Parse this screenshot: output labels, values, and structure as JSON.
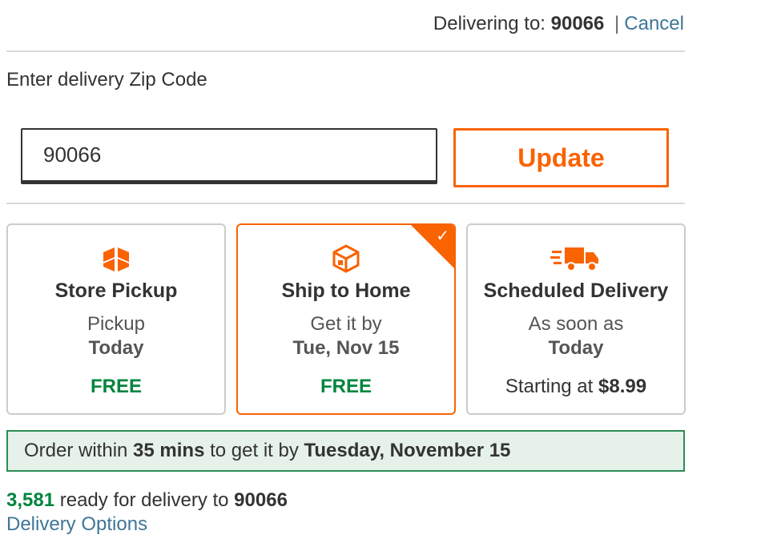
{
  "header": {
    "delivering_prefix": "Delivering to:",
    "delivering_zip": "90066",
    "separator": "|",
    "cancel_label": "Cancel"
  },
  "zip_form": {
    "label": "Enter delivery Zip Code",
    "value": "90066",
    "update_label": "Update"
  },
  "cards": [
    {
      "title": "Store Pickup",
      "line1": "Pickup",
      "line2": "Today",
      "price": "FREE",
      "icon": "store-pickup-box-icon",
      "selected": false
    },
    {
      "title": "Ship to Home",
      "line1": "Get it by",
      "line2": "Tue, Nov 15",
      "price": "FREE",
      "icon": "package-icon",
      "selected": true
    },
    {
      "title": "Scheduled Delivery",
      "line1": "As soon as",
      "line2": "Today",
      "price_prefix": "Starting at",
      "price_value": "$8.99",
      "icon": "delivery-truck-icon",
      "selected": false
    }
  ],
  "banner": {
    "prefix": "Order within",
    "time": "35 mins",
    "middle": "to get it by",
    "date": "Tuesday, November 15"
  },
  "stock": {
    "count": "3,581",
    "text": "ready for delivery to",
    "zip": "90066",
    "options_link": "Delivery Options"
  },
  "colors": {
    "accent": "#f96302",
    "green": "#00853f",
    "link": "#3e7697",
    "banner_bg": "#e6f2e9"
  }
}
